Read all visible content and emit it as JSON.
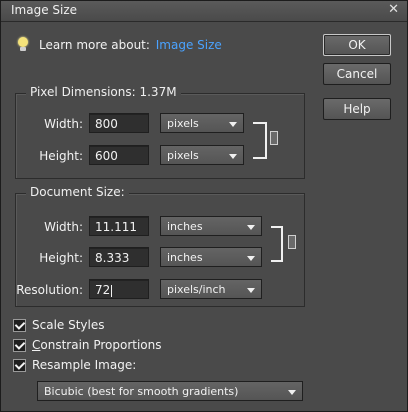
{
  "window": {
    "title": "Image Size",
    "close_glyph": "✕"
  },
  "learn": {
    "prefix": "Learn more about:",
    "link": "Image Size",
    "link_color": "#4aa3ff",
    "icon": "lightbulb-icon"
  },
  "buttons": {
    "ok": "OK",
    "cancel": "Cancel",
    "help": "Help"
  },
  "pixel_dimensions": {
    "legend": "Pixel Dimensions:",
    "size": "1.37M",
    "width_label": "Width:",
    "width_value": "800",
    "width_unit": "pixels",
    "height_label": "Height:",
    "height_value": "600",
    "height_unit": "pixels"
  },
  "document_size": {
    "legend": "Document Size:",
    "width_label": "Width:",
    "width_value": "11.111",
    "width_unit": "inches",
    "height_label": "Height:",
    "height_value": "8.333",
    "height_unit": "inches",
    "resolution_label": "Resolution:",
    "resolution_value": "72",
    "resolution_unit": "pixels/inch"
  },
  "options": {
    "scale_styles": {
      "label": "Scale Styles",
      "checked": true
    },
    "constrain_proportions": {
      "label": "Constrain Proportions",
      "checked": true
    },
    "resample_image": {
      "label": "Resample Image:",
      "checked": true
    }
  },
  "resample_method": "Bicubic (best for smooth gradients)"
}
